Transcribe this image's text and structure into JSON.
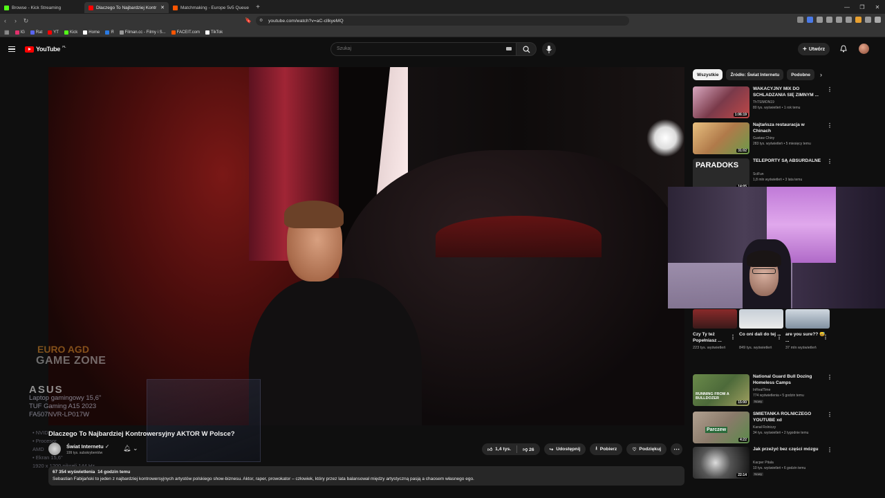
{
  "browser": {
    "tabs": [
      {
        "title": "Browse - Kick Streaming",
        "favicon": "kick-icon",
        "color": "#53fc18",
        "active": false
      },
      {
        "title": "Dlaczego To Najbardziej Kontr",
        "favicon": "youtube-icon",
        "color": "#ff0000",
        "active": true
      },
      {
        "title": "Matchmaking - Europe 5v5 Queue",
        "favicon": "faceit-icon",
        "color": "#ff5500",
        "active": false
      }
    ],
    "url": "youtube.com/watch?v=aC-cllkyeMQ",
    "bookmarks": [
      {
        "label": "IG",
        "color": "#e1306c"
      },
      {
        "label": "Rat",
        "color": "#5865f2"
      },
      {
        "label": "YT",
        "color": "#ff0000"
      },
      {
        "label": "Kick",
        "color": "#53fc18"
      },
      {
        "label": "Home",
        "color": "#ffffff"
      },
      {
        "label": "Я",
        "color": "#2a7ae2"
      },
      {
        "label": "Filman.cc - Filmy i S...",
        "color": "#999999"
      },
      {
        "label": "FACEIT.com",
        "color": "#ff5500"
      },
      {
        "label": "TikTok",
        "color": "#ffffff"
      }
    ]
  },
  "header": {
    "logo": "YouTube",
    "region": "PL",
    "search_placeholder": "Szukaj",
    "create_label": "Utwórz"
  },
  "video": {
    "title": "Dlaczego To Najbardziej Kontrowersyjny AKTOR W Polsce?",
    "channel": "Świat Internetu",
    "subscribers": "199 tys. subskrybentów",
    "likes": "1,4 tys.",
    "dislikes": "26",
    "share": "Udostępnij",
    "download": "Pobierz",
    "thanks": "Podziękuj",
    "views": "67 354 wyświetlenia",
    "posted": "14 godzin temu",
    "description": "Sebastian Fabijański to jeden z najbardziej kontrowersyjnych artystów polskiego show-biznesu. Aktor, raper, prowokator – człowiek, który przez lata balansował między artystyczną pasją a chaosem własnego ego."
  },
  "overlay_ad": {
    "store": "EURO AGD",
    "zone": "GAME ZONE",
    "brand": "ASUS",
    "line1": "Laptop gamingowy 15,6\"",
    "line2": "TUF Gaming A15 2023",
    "line3": "FA507NVR-LP017W",
    "specs": [
      "• NVID",
      "• Procesor",
      "AMD",
      "• Ekran 15,6\"",
      "1920 x 1200 pikseli 144 Hz"
    ]
  },
  "sidebar": {
    "chips": [
      "Wszystkie",
      "Źródło: Świat Internetu",
      "Podobne"
    ],
    "recs_top": [
      {
        "title": "WAKACYJNY MIX DO SCHLADZANIA SIĘ ZIMNYM ...",
        "channel": "ThTSIMON19",
        "meta": "80 tys. wyświetleń • 1 rok temu",
        "duration": "1:06:19",
        "thumb": "#7a3a4a"
      },
      {
        "title": "Najtańsza restauracja w Chinach",
        "channel": "Gustaw Chiny",
        "meta": "283 tys. wyświetleń • 5 miesięcy temu",
        "duration": "31:02",
        "thumb": "#c9a25a"
      },
      {
        "title": "TELEPORTY SĄ ABSURDALNE",
        "channel": "SciFun",
        "meta": "1,8 mln wyświetleń • 3 lata temu",
        "duration": "14:05",
        "thumb": "#2a2a2a",
        "thumb_text": "PARADOKS"
      }
    ],
    "shorts": [
      {
        "title": "Czy Ty też Popełniasz ...",
        "views": "223 tys. wyświetleń"
      },
      {
        "title": "Co oni dali do tej ...",
        "views": "849 tys. wyświetleń"
      },
      {
        "title": "are you sure?? 😅 ...",
        "views": "37 mln wyświetleń"
      }
    ],
    "recs_bottom": [
      {
        "title": "National Guard Bull Dozing Homeless Camps",
        "channel": "InRealTime",
        "meta": "774 wyświetlenia • 5 godzin temu",
        "badge": "Nowy",
        "duration": "15:00",
        "thumb": "#4d6a3a",
        "thumb_text": "RUNNING FROM A BULLDOZER"
      },
      {
        "title": "ŚMIETANKA ROLNICZEGO YOUTUBE xd",
        "channel": "Kanał Rolniczy",
        "meta": "34 tys. wyświetleń • 2 tygodnie temu",
        "badge": "",
        "duration": "4:22",
        "thumb": "#8a7a6a",
        "thumb_text": "Parczew"
      },
      {
        "title": "Jak przeżyć bez części mózgu",
        "channel": "Kacper Pitala",
        "meta": "10 tys. wyświetleń • 6 godzin temu",
        "badge": "Nowy",
        "duration": "22:14",
        "thumb": "#1a1a1a"
      }
    ]
  }
}
